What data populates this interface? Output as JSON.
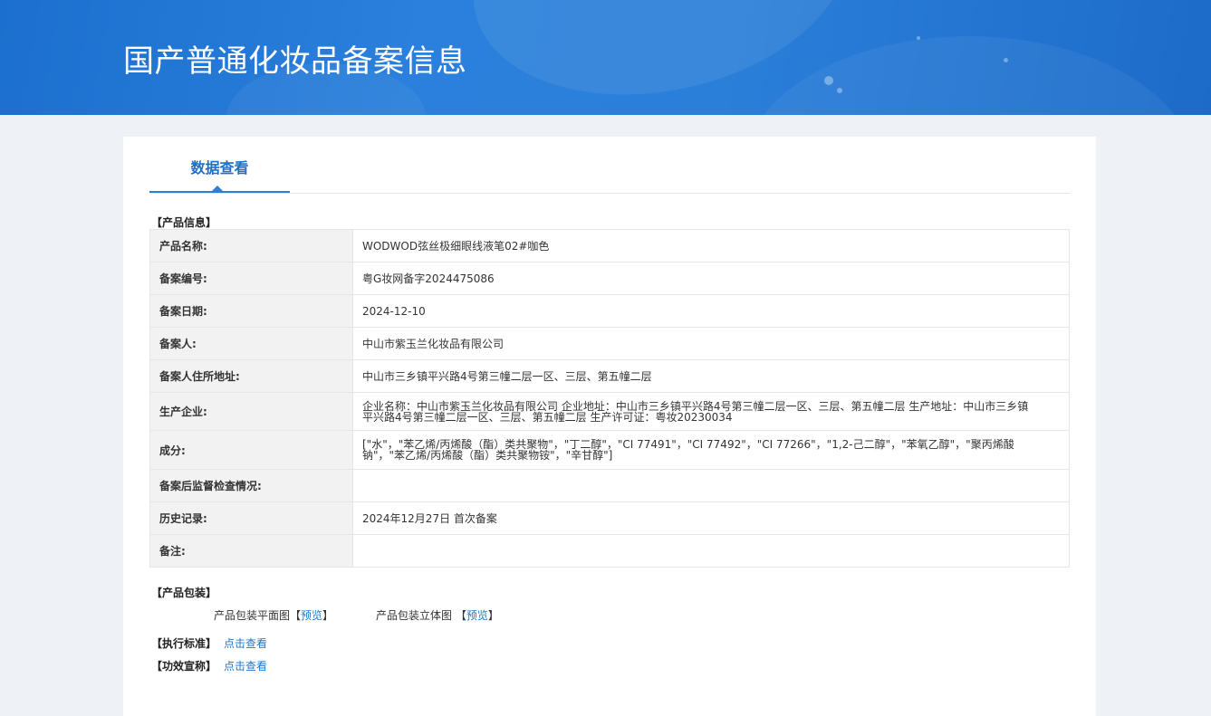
{
  "header": {
    "title": "国产普通化妆品备案信息"
  },
  "tabs": [
    {
      "label": "数据查看",
      "active": true
    }
  ],
  "product_info": {
    "section_label": "【产品信息】",
    "rows": [
      {
        "key": "产品名称:",
        "value": "WODWOD弦丝极细眼线液笔02#咖色"
      },
      {
        "key": "备案编号:",
        "value": "粤G妆网备字2024475086"
      },
      {
        "key": "备案日期:",
        "value": "2024-12-10"
      },
      {
        "key": "备案人:",
        "value": "中山市紫玉兰化妆品有限公司"
      },
      {
        "key": "备案人住所地址:",
        "value": "中山市三乡镇平兴路4号第三幢二层一区、三层、第五幢二层"
      },
      {
        "key": "生产企业:",
        "value": "企业名称：中山市紫玉兰化妆品有限公司 企业地址：中山市三乡镇平兴路4号第三幢二层一区、三层、第五幢二层 生产地址：中山市三乡镇平兴路4号第三幢二层一区、三层、第五幢二层 生产许可证：粤妆20230034"
      },
      {
        "key": "成分:",
        "value": "[\"水\"，\"苯乙烯/丙烯酸（酯）类共聚物\"，\"丁二醇\"，\"CI 77491\"，\"CI 77492\"，\"CI 77266\"，\"1,2-己二醇\"，\"苯氧乙醇\"，\"聚丙烯酸钠\"，\"苯乙烯/丙烯酸（酯）类共聚物铵\"，\"辛甘醇\"]"
      },
      {
        "key": "备案后监督检查情况:",
        "value": ""
      },
      {
        "key": "历史记录:",
        "value": "2024年12月27日 首次备案"
      },
      {
        "key": "备注:",
        "value": ""
      }
    ]
  },
  "packaging": {
    "section_label": "【产品包装】",
    "flat_label": "产品包装平面图",
    "stereo_label": "产品包装立体图",
    "bracket_open": "【",
    "bracket_close": "】",
    "preview_link": "预览"
  },
  "standard": {
    "label": "【执行标准】",
    "link": "点击查看"
  },
  "efficacy": {
    "label": "【功效宣称】",
    "link": "点击查看"
  }
}
